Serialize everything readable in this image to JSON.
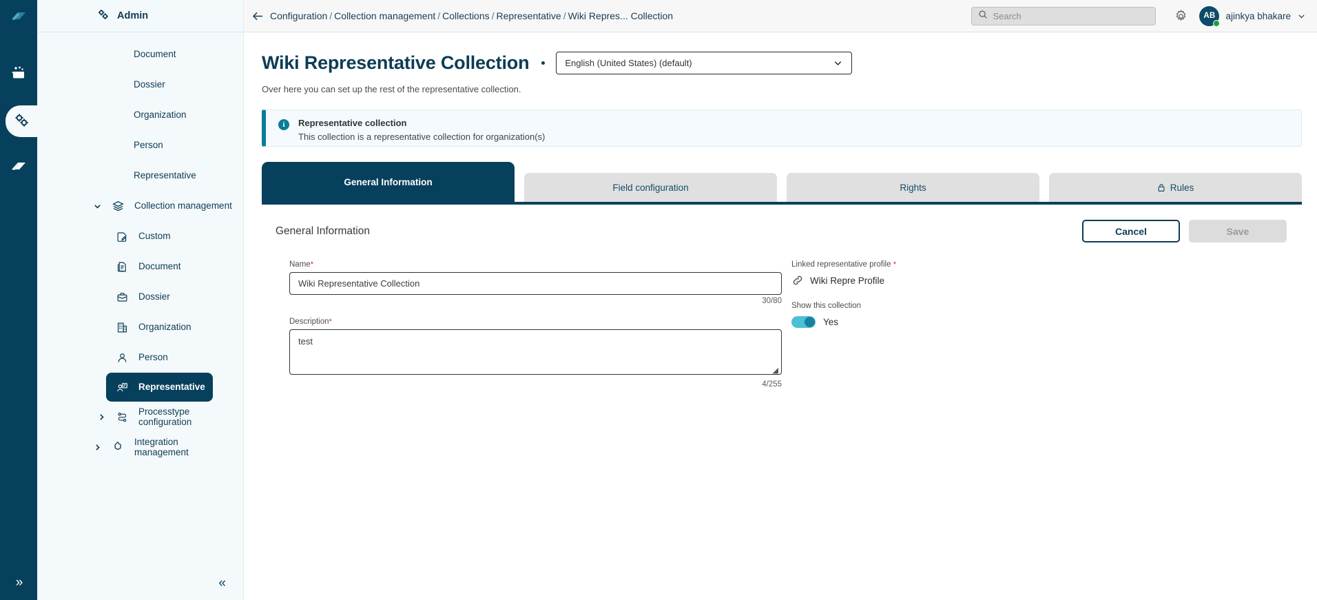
{
  "rail": {
    "logo_icon": "app-logo-icon",
    "items": [
      {
        "icon": "briefcase-people-icon",
        "name": "workspace"
      },
      {
        "icon": "gears-icon",
        "name": "admin",
        "active": true
      },
      {
        "icon": "layers-icon",
        "name": "archive"
      }
    ],
    "expand_label": "»"
  },
  "sidebar": {
    "header": {
      "icon": "gears-icon",
      "title": "Admin"
    },
    "items": [
      {
        "label": "Document",
        "level": "plain",
        "icon": null,
        "caret": null,
        "selected": false
      },
      {
        "label": "Dossier",
        "level": "plain",
        "icon": null,
        "caret": null,
        "selected": false
      },
      {
        "label": "Organization",
        "level": "plain",
        "icon": null,
        "caret": null,
        "selected": false
      },
      {
        "label": "Person",
        "level": "plain",
        "icon": null,
        "caret": null,
        "selected": false
      },
      {
        "label": "Representative",
        "level": "plain",
        "icon": null,
        "caret": null,
        "selected": false
      },
      {
        "label": "Collection management",
        "level": "group",
        "icon": "layers-icon",
        "caret": "down",
        "selected": false
      },
      {
        "label": "Custom",
        "level": "child",
        "icon": "document-edit-icon",
        "caret": null,
        "selected": false
      },
      {
        "label": "Document",
        "level": "child",
        "icon": "document-icon",
        "caret": null,
        "selected": false
      },
      {
        "label": "Dossier",
        "level": "child",
        "icon": "briefcase-icon",
        "caret": null,
        "selected": false
      },
      {
        "label": "Organization",
        "level": "child",
        "icon": "building-icon",
        "caret": null,
        "selected": false
      },
      {
        "label": "Person",
        "level": "child",
        "icon": "person-icon",
        "caret": null,
        "selected": false
      },
      {
        "label": "Representative",
        "level": "child",
        "icon": "representative-icon",
        "caret": null,
        "selected": true
      },
      {
        "label": "Processtype configuration",
        "level": "child2",
        "icon": "process-icon",
        "caret": "right",
        "selected": false
      },
      {
        "label": "Integration management",
        "level": "group",
        "icon": "puzzle-icon",
        "caret": "right",
        "selected": false
      }
    ],
    "collapse_label": "«"
  },
  "topbar": {
    "back_icon": "back-arrow-icon",
    "breadcrumb": [
      "Configuration",
      "Collection management",
      "Collections",
      "Representative",
      "Wiki Repres... Collection"
    ],
    "breadcrumb_separator": "/",
    "search": {
      "icon": "search-icon",
      "placeholder": "Search",
      "value": ""
    },
    "settings_icon": "gear-icon",
    "user": {
      "initials": "AB",
      "name": "ajinkya bhakare",
      "status": "online",
      "caret_icon": "chevron-down-icon"
    }
  },
  "page": {
    "title": "Wiki Representative Collection",
    "language": {
      "value": "English (United States) (default)",
      "caret_icon": "chevron-down-icon"
    },
    "subtitle": "Over here you can set up the rest of the representative collection.",
    "banner": {
      "icon": "info-icon",
      "title": "Representative collection",
      "text": "This collection is a representative collection for organization(s)"
    },
    "tabs": [
      {
        "label": "General Information",
        "active": true,
        "icon": null
      },
      {
        "label": "Field configuration",
        "active": false,
        "icon": null
      },
      {
        "label": "Rights",
        "active": false,
        "icon": null
      },
      {
        "label": "Rules",
        "active": false,
        "icon": "lock-icon"
      }
    ],
    "panel": {
      "title": "General Information",
      "cancel_label": "Cancel",
      "save_label": "Save",
      "name_field": {
        "label": "Name",
        "required": "*",
        "value": "Wiki Representative Collection",
        "counter": "30/80"
      },
      "description_field": {
        "label": "Description",
        "required": "*",
        "value": "test",
        "counter": "4/255"
      },
      "linked_profile": {
        "label": "Linked representative profile",
        "required": "*",
        "icon": "link-icon",
        "value": "Wiki Repre Profile"
      },
      "show_collection": {
        "label": "Show this collection",
        "state": "on",
        "state_label": "Yes"
      }
    }
  },
  "colors": {
    "brand_dark": "#06405c",
    "sidebar_bg": "#f4f9fb",
    "accent_teal": "#0a7b99",
    "toggle_on": "#4cc0d6",
    "required_red": "#e02020",
    "tab_inactive": "#e0e0e0"
  }
}
